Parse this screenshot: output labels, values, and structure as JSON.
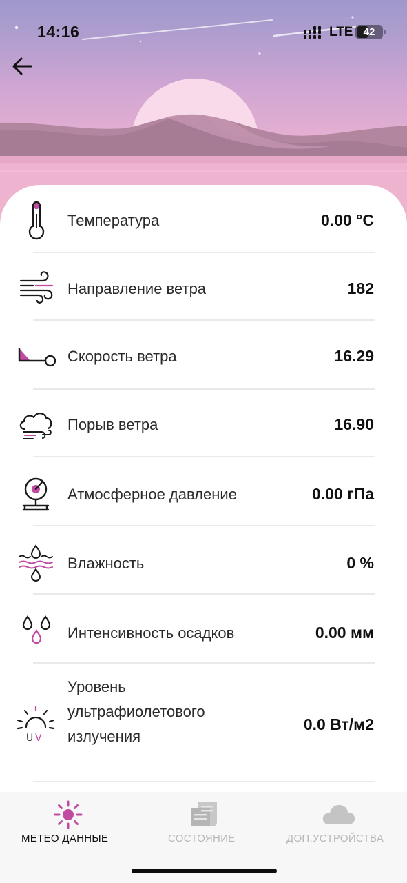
{
  "status_bar": {
    "time": "14:16",
    "network": "LTE",
    "battery": "42"
  },
  "colors": {
    "accent": "#c04ba1",
    "inactive": "#b5b5b5",
    "icon": "#1a1a1a",
    "divider": "#e9e9e9"
  },
  "metrics": [
    {
      "icon": "thermometer-icon",
      "label": "Температура",
      "value": "0.00 °C"
    },
    {
      "icon": "wind-direction-icon",
      "label": "Направление ветра",
      "value": "182"
    },
    {
      "icon": "wind-speed-icon",
      "label": "Скорость ветра",
      "value": "16.29"
    },
    {
      "icon": "wind-gust-icon",
      "label": "Порыв ветра",
      "value": "16.90"
    },
    {
      "icon": "barometer-icon",
      "label": "Атмосферное давление",
      "value": "0.00 гПа"
    },
    {
      "icon": "humidity-icon",
      "label": "Влажность",
      "value": "0 %"
    },
    {
      "icon": "precipitation-icon",
      "label": "Интенсивность осадков",
      "value": "0.00 мм"
    },
    {
      "icon": "uv-icon",
      "label_lines": [
        "Уровень",
        "ультрафиолетового",
        "излучения"
      ],
      "value": "0.0 Вт/м2"
    }
  ],
  "tabs": [
    {
      "icon": "sun-icon",
      "label": "МЕТЕО ДАННЫЕ",
      "active": true
    },
    {
      "icon": "document-icon",
      "label": "СОСТОЯНИЕ",
      "active": false
    },
    {
      "icon": "cloud-icon",
      "label": "ДОП.УСТРОЙСТВА",
      "active": false
    }
  ]
}
